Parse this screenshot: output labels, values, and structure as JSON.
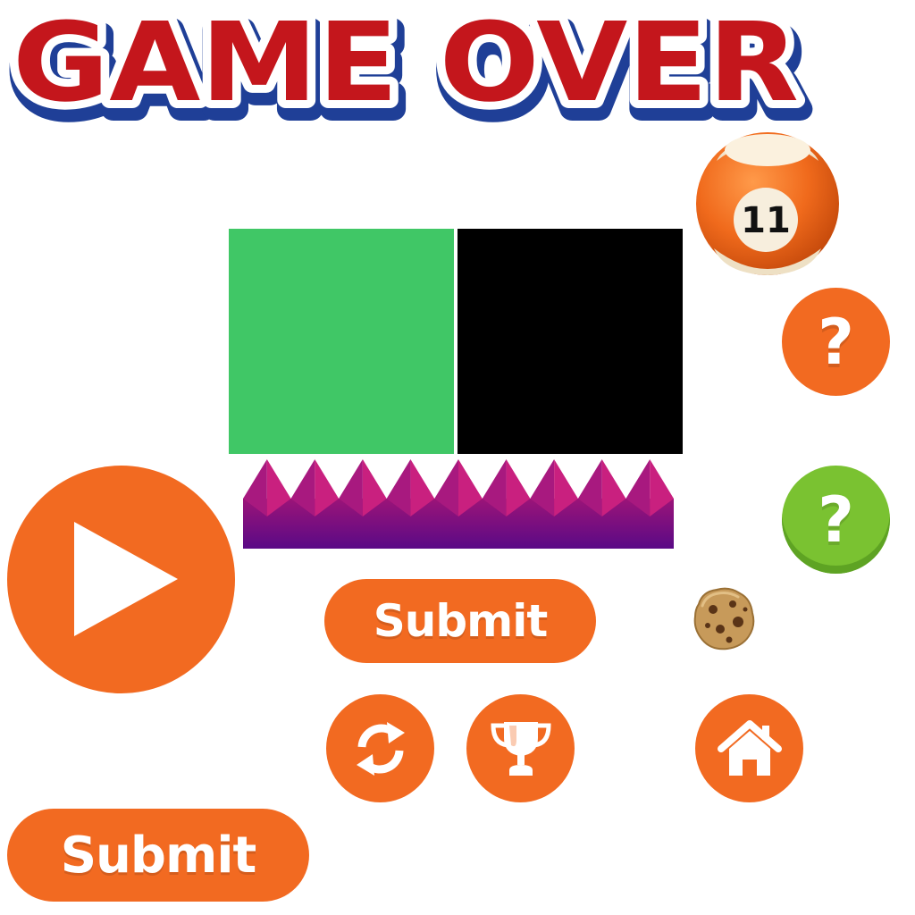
{
  "title": {
    "text": "GAME OVER"
  },
  "tiles": {
    "green": "#40c766",
    "black": "#000000"
  },
  "colors": {
    "button_orange": "#f26a21",
    "button_green": "#7ac231",
    "title_red": "#c4161c",
    "title_blue": "#1f3f97",
    "spike_top": "#c2187f",
    "spike_bottom": "#5a0a86"
  },
  "pool_ball": {
    "number": "11"
  },
  "buttons": {
    "help_orange": {
      "label": "?"
    },
    "help_green": {
      "label": "?"
    },
    "submit_1": {
      "label": "Submit"
    },
    "submit_2": {
      "label": "Submit"
    },
    "play": {
      "icon": "play-icon"
    },
    "restart": {
      "icon": "refresh-icon"
    },
    "trophy": {
      "icon": "trophy-icon"
    },
    "home": {
      "icon": "home-icon"
    }
  },
  "cookie": {
    "icon": "cookie-icon"
  }
}
